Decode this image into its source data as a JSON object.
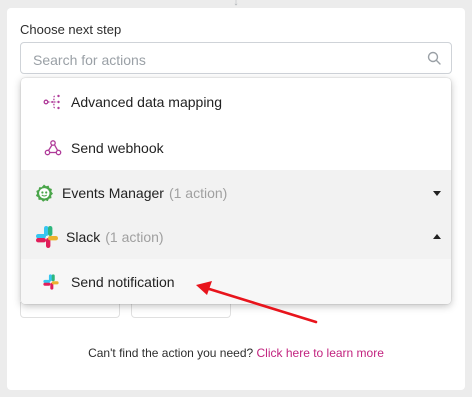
{
  "step": {
    "title": "Choose next step",
    "search_placeholder": "Search for actions"
  },
  "dropdown": {
    "items": [
      {
        "label": "Advanced data mapping",
        "icon": "data-mapping-icon"
      },
      {
        "label": "Send webhook",
        "icon": "webhook-icon"
      }
    ],
    "groups": [
      {
        "label": "Events Manager",
        "count": "(1 action)",
        "icon": "events-manager-icon",
        "expanded": false
      },
      {
        "label": "Slack",
        "count": "(1 action)",
        "icon": "slack-icon",
        "expanded": true
      }
    ],
    "sub_items": [
      {
        "label": "Send notification",
        "icon": "slack-icon"
      }
    ]
  },
  "footer": {
    "text": "Can't find the action you need?",
    "link": "Click here to learn more"
  },
  "colors": {
    "accent": "#c2237f",
    "annotation_arrow": "#e8141c",
    "group_bg": "#f2f2f2"
  }
}
